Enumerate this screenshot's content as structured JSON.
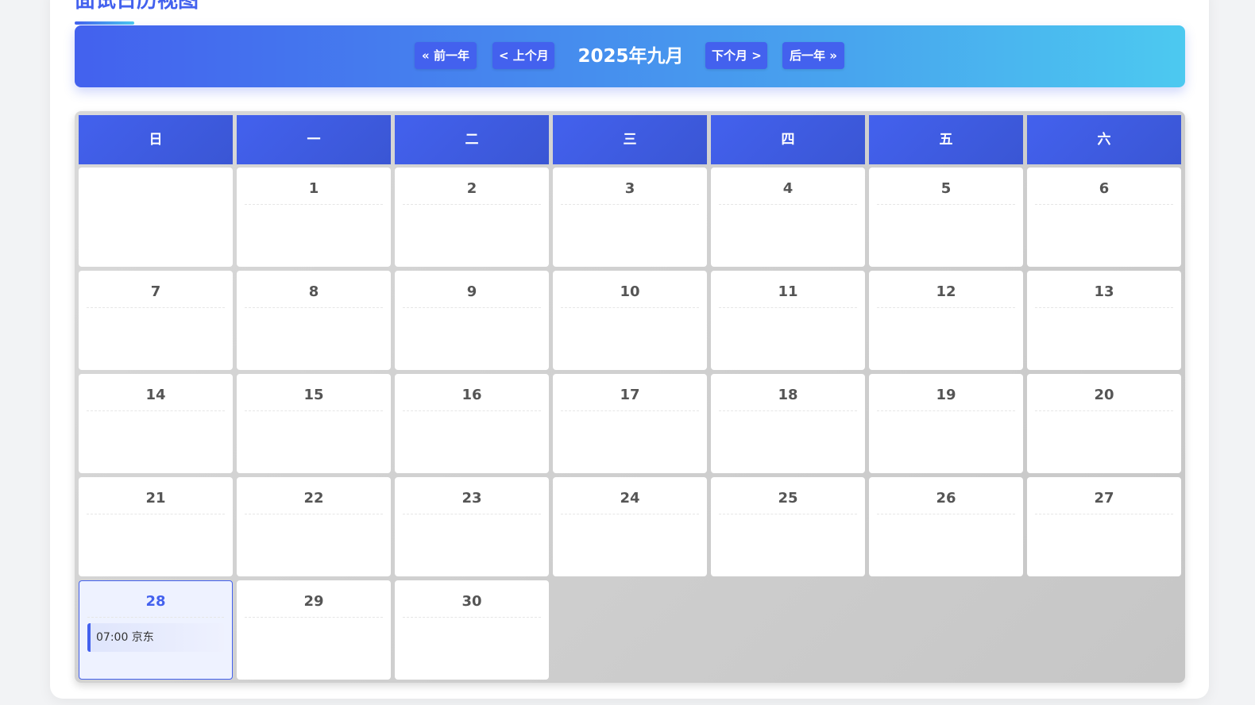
{
  "page": {
    "title": "面试日历视图"
  },
  "nav": {
    "prev_year_label": "« 前一年",
    "prev_month_label": "< 上个月",
    "current_month": "2025年九月",
    "next_month_label": "下个月 >",
    "next_year_label": "后一年 »"
  },
  "calendar": {
    "weekdays": [
      "日",
      "一",
      "二",
      "三",
      "四",
      "五",
      "六"
    ],
    "days": [
      "1",
      "2",
      "3",
      "4",
      "5",
      "6",
      "7",
      "8",
      "9",
      "10",
      "11",
      "12",
      "13",
      "14",
      "15",
      "16",
      "17",
      "18",
      "19",
      "20",
      "21",
      "22",
      "23",
      "24",
      "25",
      "26",
      "27",
      "28",
      "29",
      "30"
    ],
    "today": "28",
    "events": [
      {
        "day": "28",
        "label": "07:00 京东"
      }
    ]
  },
  "colors": {
    "accent": "#4361ee",
    "accent_light": "#4cc9f0",
    "today_bg": "#eef2ff"
  }
}
